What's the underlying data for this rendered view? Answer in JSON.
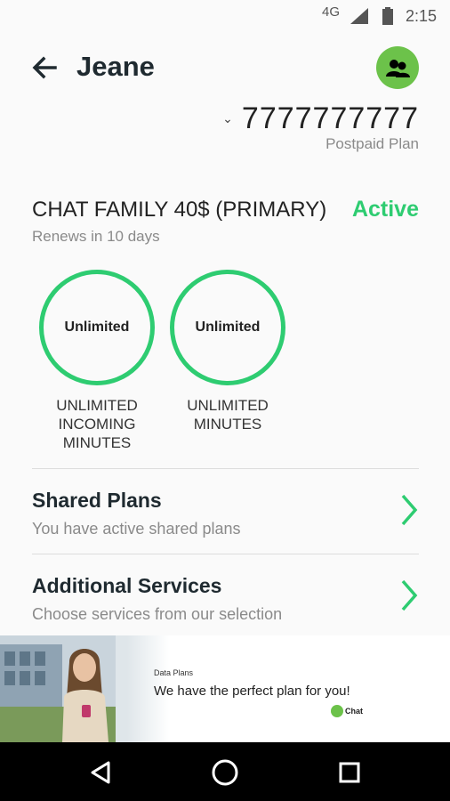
{
  "status_bar": {
    "network": "4G",
    "time": "2:15"
  },
  "header": {
    "title": "Jeane",
    "back_icon": "arrow-left-icon",
    "avatar_icon": "group-icon"
  },
  "account": {
    "phone_number": "7777777777",
    "plan_type": "Postpaid Plan"
  },
  "plan": {
    "name": "CHAT FAMILY 40$ (PRIMARY)",
    "status": "Active",
    "renews": "Renews in 10 days"
  },
  "usage": [
    {
      "value": "Unlimited",
      "label": "UNLIMITED INCOMING MINUTES"
    },
    {
      "value": "Unlimited",
      "label": "UNLIMITED MINUTES"
    }
  ],
  "list": [
    {
      "title": "Shared Plans",
      "subtitle": "You have active shared plans"
    },
    {
      "title": "Additional Services",
      "subtitle": "Choose services from our selection"
    }
  ],
  "banner": {
    "small_label": "Data Plans",
    "headline": "We have the perfect plan for you!",
    "logo_text": "Chat"
  },
  "colors": {
    "accent_green": "#2ecc71",
    "avatar_green": "#6cc24a",
    "title_dark": "#1f2a30"
  }
}
